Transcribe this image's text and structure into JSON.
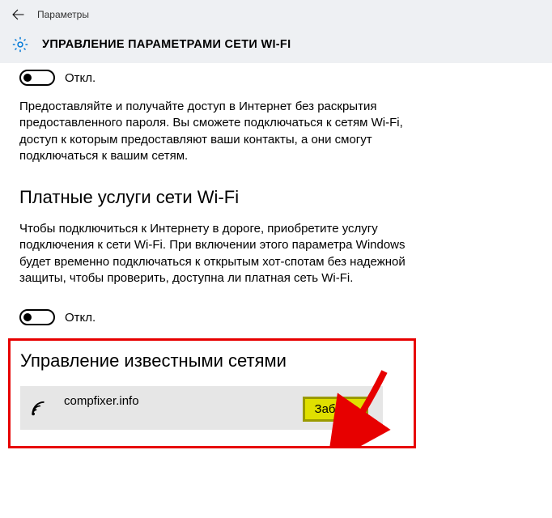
{
  "header": {
    "top_title": "Параметры",
    "page_title": "УПРАВЛЕНИЕ ПАРАМЕТРАМИ СЕТИ WI-FI"
  },
  "toggle1": {
    "state_label": "Откл.",
    "on": false
  },
  "desc1": "Предоставляйте и получайте доступ в Интернет без раскрытия предоставленного пароля. Вы сможете подключаться к сетям Wi-Fi, доступ к которым предоставляют ваши контакты, а они смогут подключаться к вашим сетям.",
  "section_paid": {
    "heading": "Платные услуги сети Wi-Fi",
    "desc": "Чтобы подключиться к Интернету в дороге, приобретите услугу подключения к сети Wi-Fi. При включении этого параметра Windows будет временно подключаться к открытым хот-спотам без надежной защиты, чтобы проверить, доступна ли платная сеть Wi-Fi.",
    "toggle_label": "Откл.",
    "on": false
  },
  "section_known": {
    "heading": "Управление известными сетями",
    "networks": [
      {
        "name": "compfixer.info",
        "forget_label": "Забыть"
      }
    ]
  }
}
